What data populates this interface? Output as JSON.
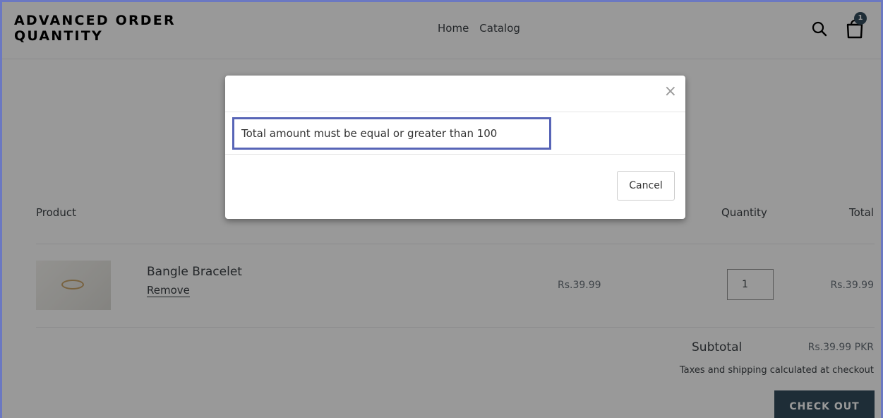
{
  "header": {
    "logo_text": "ADVANCED ORDER QUANTITY",
    "nav": [
      {
        "label": "Home"
      },
      {
        "label": "Catalog"
      }
    ],
    "cart_count": "1"
  },
  "cart": {
    "columns": {
      "product": "Product",
      "quantity": "Quantity",
      "total": "Total"
    },
    "items": [
      {
        "title": "Bangle Bracelet",
        "remove_label": "Remove",
        "price": "Rs.39.99",
        "quantity": "1",
        "line_total": "Rs.39.99"
      }
    ],
    "subtotal_label": "Subtotal",
    "subtotal_value": "Rs.39.99 PKR",
    "tax_note": "Taxes and shipping calculated at checkout",
    "checkout_label": "CHECK OUT"
  },
  "modal": {
    "close_glyph": "×",
    "message": "Total amount must be equal or greater than 100",
    "cancel_label": "Cancel"
  },
  "colors": {
    "accent": "#334c5c",
    "highlight_border": "#5865b7",
    "overlay": "rgba(0,0,0,0.4)"
  }
}
